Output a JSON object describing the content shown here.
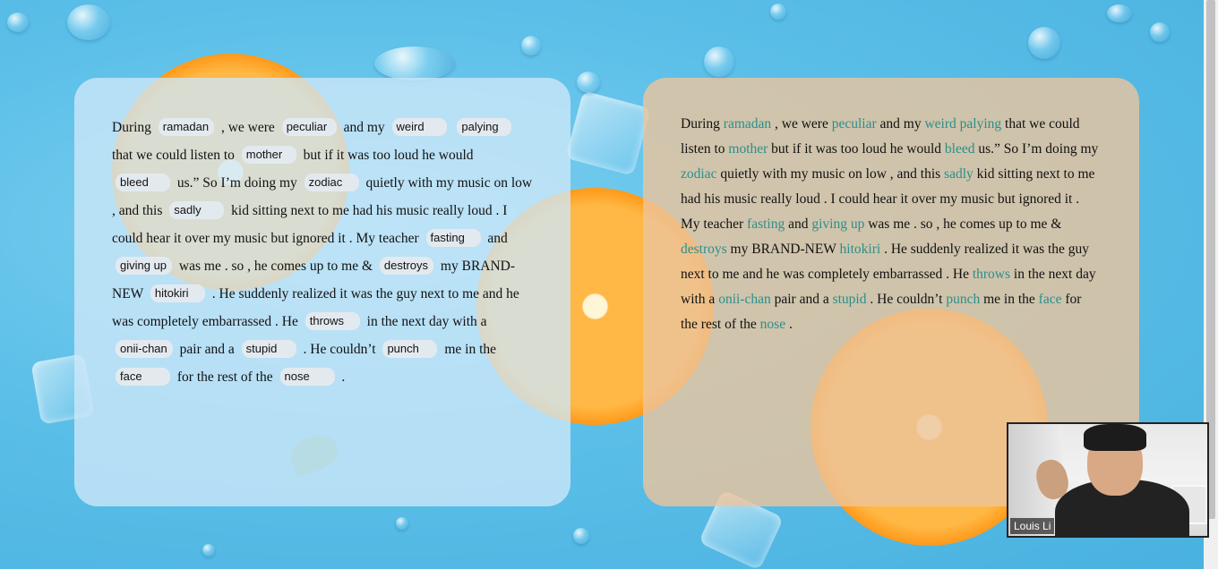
{
  "story": [
    {
      "t": "During"
    },
    {
      "b": "ramadan",
      "f": "ramadan",
      "w": "w60"
    },
    {
      "t": ", we were"
    },
    {
      "b": "peculiar",
      "f": "peculiar",
      "w": "w60"
    },
    {
      "t": "and my"
    },
    {
      "b": "weird",
      "f": "weird",
      "w": "w60"
    },
    {
      "b": "palying",
      "f": "palying",
      "w": "w60"
    },
    {
      "t": "that we could listen to"
    },
    {
      "b": "mother",
      "f": "mother",
      "w": "w60"
    },
    {
      "t": "but if it was too loud he would"
    },
    {
      "b": "bleed",
      "f": "bleed",
      "w": "w60"
    },
    {
      "t": "us.”  So I’m doing my"
    },
    {
      "b": "zodiac",
      "f": "zodiac",
      "w": "w60"
    },
    {
      "t": "quietly with my music on low , and this"
    },
    {
      "b": "sadly",
      "f": "sadly",
      "w": "w60"
    },
    {
      "t": "kid sitting next to me had his music really loud . I could hear it over my music but ignored it . My teacher"
    },
    {
      "b": "fasting",
      "f": "fasting",
      "w": "w60"
    },
    {
      "t": "and"
    },
    {
      "b": "giving up",
      "f": "giving up",
      "w": "w55"
    },
    {
      "t": "was me . so , he comes up to me &"
    },
    {
      "b": "destroys",
      "f": "destroys",
      "w": "w55"
    },
    {
      "t": "my BRAND-NEW"
    },
    {
      "b": "hitokiri",
      "f": "hitokiri",
      "w": "w60"
    },
    {
      "t": ". He suddenly realized it was the guy next to me and he was completely embarrassed . He"
    },
    {
      "b": "throws",
      "f": "throws",
      "w": "w60"
    },
    {
      "t": "in the next day with a"
    },
    {
      "b": "onii-chan",
      "f": "onii-chan",
      "w": "w50"
    },
    {
      "t": "pair and a"
    },
    {
      "b": "stupid",
      "f": "stupid",
      "w": "w60"
    },
    {
      "t": ". He couldn’t"
    },
    {
      "b": "punch",
      "f": "punch",
      "w": "w60"
    },
    {
      "t": "me in the"
    },
    {
      "b": "face",
      "f": "face",
      "w": "w60"
    },
    {
      "t": "for the rest of the"
    },
    {
      "b": "nose",
      "f": "nose",
      "w": "w60"
    },
    {
      "t": "."
    }
  ],
  "right_story": [
    {
      "t": "During"
    },
    {
      "f": "ramadan"
    },
    {
      "t": ", we were"
    },
    {
      "f": "peculiar"
    },
    {
      "t": "and my"
    },
    {
      "f": "weird palying"
    },
    {
      "t": "that we could listen to"
    },
    {
      "f": "mother"
    },
    {
      "t": "but if it was too loud he would"
    },
    {
      "f": "bleed"
    },
    {
      "t": "us.”  So I’m doing my"
    },
    {
      "f": "zodiac"
    },
    {
      "t": "quietly with my music on low , and this"
    },
    {
      "f": "sadly"
    },
    {
      "t": "kid sitting next to me had his music really loud . I could hear it over my music but ignored it . My teacher"
    },
    {
      "f": "fasting"
    },
    {
      "t": "and"
    },
    {
      "f": "giving up"
    },
    {
      "t": "was me . so , he comes up to me &"
    },
    {
      "f": "destroys"
    },
    {
      "t": "my BRAND-NEW"
    },
    {
      "f": "hitokiri"
    },
    {
      "t": ". He suddenly realized it was the guy next to me and he was completely embarrassed . He"
    },
    {
      "f": "throws"
    },
    {
      "t": "in the next day with a"
    },
    {
      "f": "onii-chan"
    },
    {
      "t": "pair and a"
    },
    {
      "f": "stupid"
    },
    {
      "t": ". He couldn’t"
    },
    {
      "f": "punch"
    },
    {
      "t": "me in the"
    },
    {
      "f": "face"
    },
    {
      "t": "for the rest of the"
    },
    {
      "f": "nose"
    },
    {
      "t": "."
    }
  ],
  "video": {
    "participant_name": "Louis Li"
  },
  "colors": {
    "filled_word": "#2a8f8a",
    "left_panel": "#cee8f8",
    "right_panel": "#ecc49c"
  }
}
